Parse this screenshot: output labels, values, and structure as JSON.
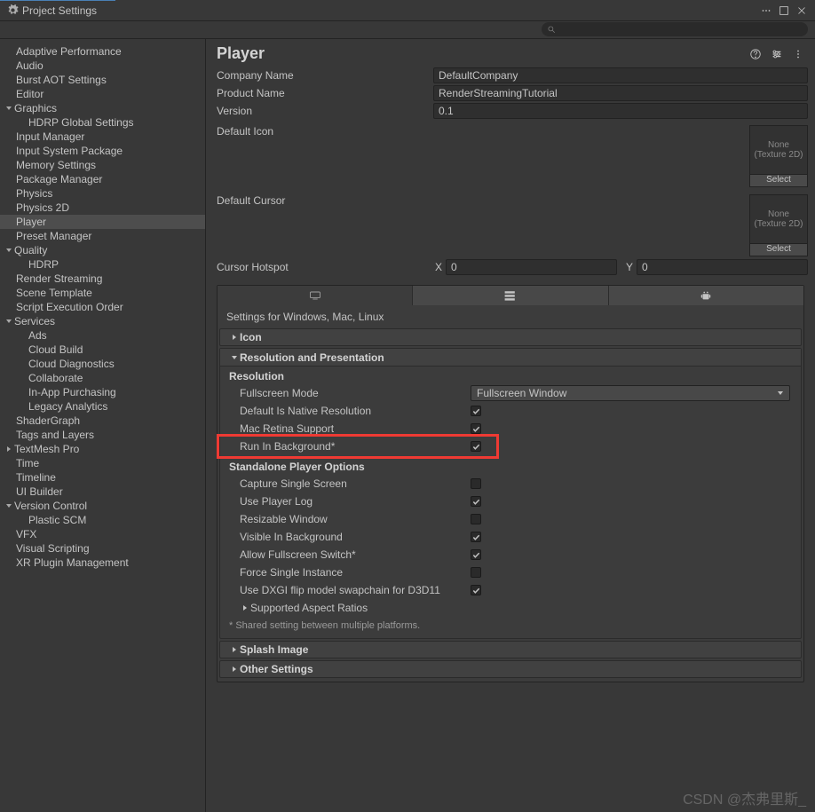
{
  "window": {
    "title": "Project Settings"
  },
  "sidebar": [
    {
      "label": "Adaptive Performance",
      "lvl": 1
    },
    {
      "label": "Audio",
      "lvl": 1
    },
    {
      "label": "Burst AOT Settings",
      "lvl": 1
    },
    {
      "label": "Editor",
      "lvl": 1
    },
    {
      "label": "Graphics",
      "lvl": 1,
      "foldout": "down"
    },
    {
      "label": "HDRP Global Settings",
      "lvl": 2
    },
    {
      "label": "Input Manager",
      "lvl": 1
    },
    {
      "label": "Input System Package",
      "lvl": 1
    },
    {
      "label": "Memory Settings",
      "lvl": 1
    },
    {
      "label": "Package Manager",
      "lvl": 1
    },
    {
      "label": "Physics",
      "lvl": 1
    },
    {
      "label": "Physics 2D",
      "lvl": 1
    },
    {
      "label": "Player",
      "lvl": 1,
      "selected": true
    },
    {
      "label": "Preset Manager",
      "lvl": 1
    },
    {
      "label": "Quality",
      "lvl": 1,
      "foldout": "down"
    },
    {
      "label": "HDRP",
      "lvl": 2
    },
    {
      "label": "Render Streaming",
      "lvl": 1
    },
    {
      "label": "Scene Template",
      "lvl": 1
    },
    {
      "label": "Script Execution Order",
      "lvl": 1
    },
    {
      "label": "Services",
      "lvl": 1,
      "foldout": "down"
    },
    {
      "label": "Ads",
      "lvl": 2
    },
    {
      "label": "Cloud Build",
      "lvl": 2
    },
    {
      "label": "Cloud Diagnostics",
      "lvl": 2
    },
    {
      "label": "Collaborate",
      "lvl": 2
    },
    {
      "label": "In-App Purchasing",
      "lvl": 2
    },
    {
      "label": "Legacy Analytics",
      "lvl": 2
    },
    {
      "label": "ShaderGraph",
      "lvl": 1
    },
    {
      "label": "Tags and Layers",
      "lvl": 1
    },
    {
      "label": "TextMesh Pro",
      "lvl": 1,
      "foldout": "right"
    },
    {
      "label": "Time",
      "lvl": 1
    },
    {
      "label": "Timeline",
      "lvl": 1
    },
    {
      "label": "UI Builder",
      "lvl": 1
    },
    {
      "label": "Version Control",
      "lvl": 1,
      "foldout": "down"
    },
    {
      "label": "Plastic SCM",
      "lvl": 2
    },
    {
      "label": "VFX",
      "lvl": 1
    },
    {
      "label": "Visual Scripting",
      "lvl": 1
    },
    {
      "label": "XR Plugin Management",
      "lvl": 1
    }
  ],
  "header": {
    "title": "Player"
  },
  "props": {
    "company_label": "Company Name",
    "company_value": "DefaultCompany",
    "product_label": "Product Name",
    "product_value": "RenderStreamingTutorial",
    "version_label": "Version",
    "version_value": "0.1",
    "default_icon_label": "Default Icon",
    "default_cursor_label": "Default Cursor",
    "asset_none": "None",
    "asset_type": "(Texture 2D)",
    "asset_select": "Select",
    "cursor_hotspot_label": "Cursor Hotspot",
    "x_label": "X",
    "x_value": "0",
    "y_label": "Y",
    "y_value": "0"
  },
  "tabs": {
    "settings_for": "Settings for Windows, Mac, Linux"
  },
  "sections": {
    "icon": "Icon",
    "resolution": "Resolution and Presentation",
    "splash": "Splash Image",
    "other": "Other Settings"
  },
  "resolution": {
    "group_title": "Resolution",
    "fullscreen_mode_label": "Fullscreen Mode",
    "fullscreen_mode_value": "Fullscreen Window",
    "default_native_label": "Default Is Native Resolution",
    "default_native_checked": true,
    "mac_retina_label": "Mac Retina Support",
    "mac_retina_checked": true,
    "run_bg_label": "Run In Background*",
    "run_bg_checked": true,
    "standalone_title": "Standalone Player Options",
    "capture_single_label": "Capture Single Screen",
    "capture_single_checked": false,
    "use_player_log_label": "Use Player Log",
    "use_player_log_checked": true,
    "resizable_label": "Resizable Window",
    "resizable_checked": false,
    "visible_bg_label": "Visible In Background",
    "visible_bg_checked": true,
    "allow_fs_label": "Allow Fullscreen Switch*",
    "allow_fs_checked": true,
    "force_single_label": "Force Single Instance",
    "force_single_checked": false,
    "dxgi_label": "Use DXGI flip model swapchain for D3D11",
    "dxgi_checked": true,
    "supported_aspect": "Supported Aspect Ratios",
    "footnote": "* Shared setting between multiple platforms."
  },
  "watermark": "CSDN @杰弗里斯_"
}
